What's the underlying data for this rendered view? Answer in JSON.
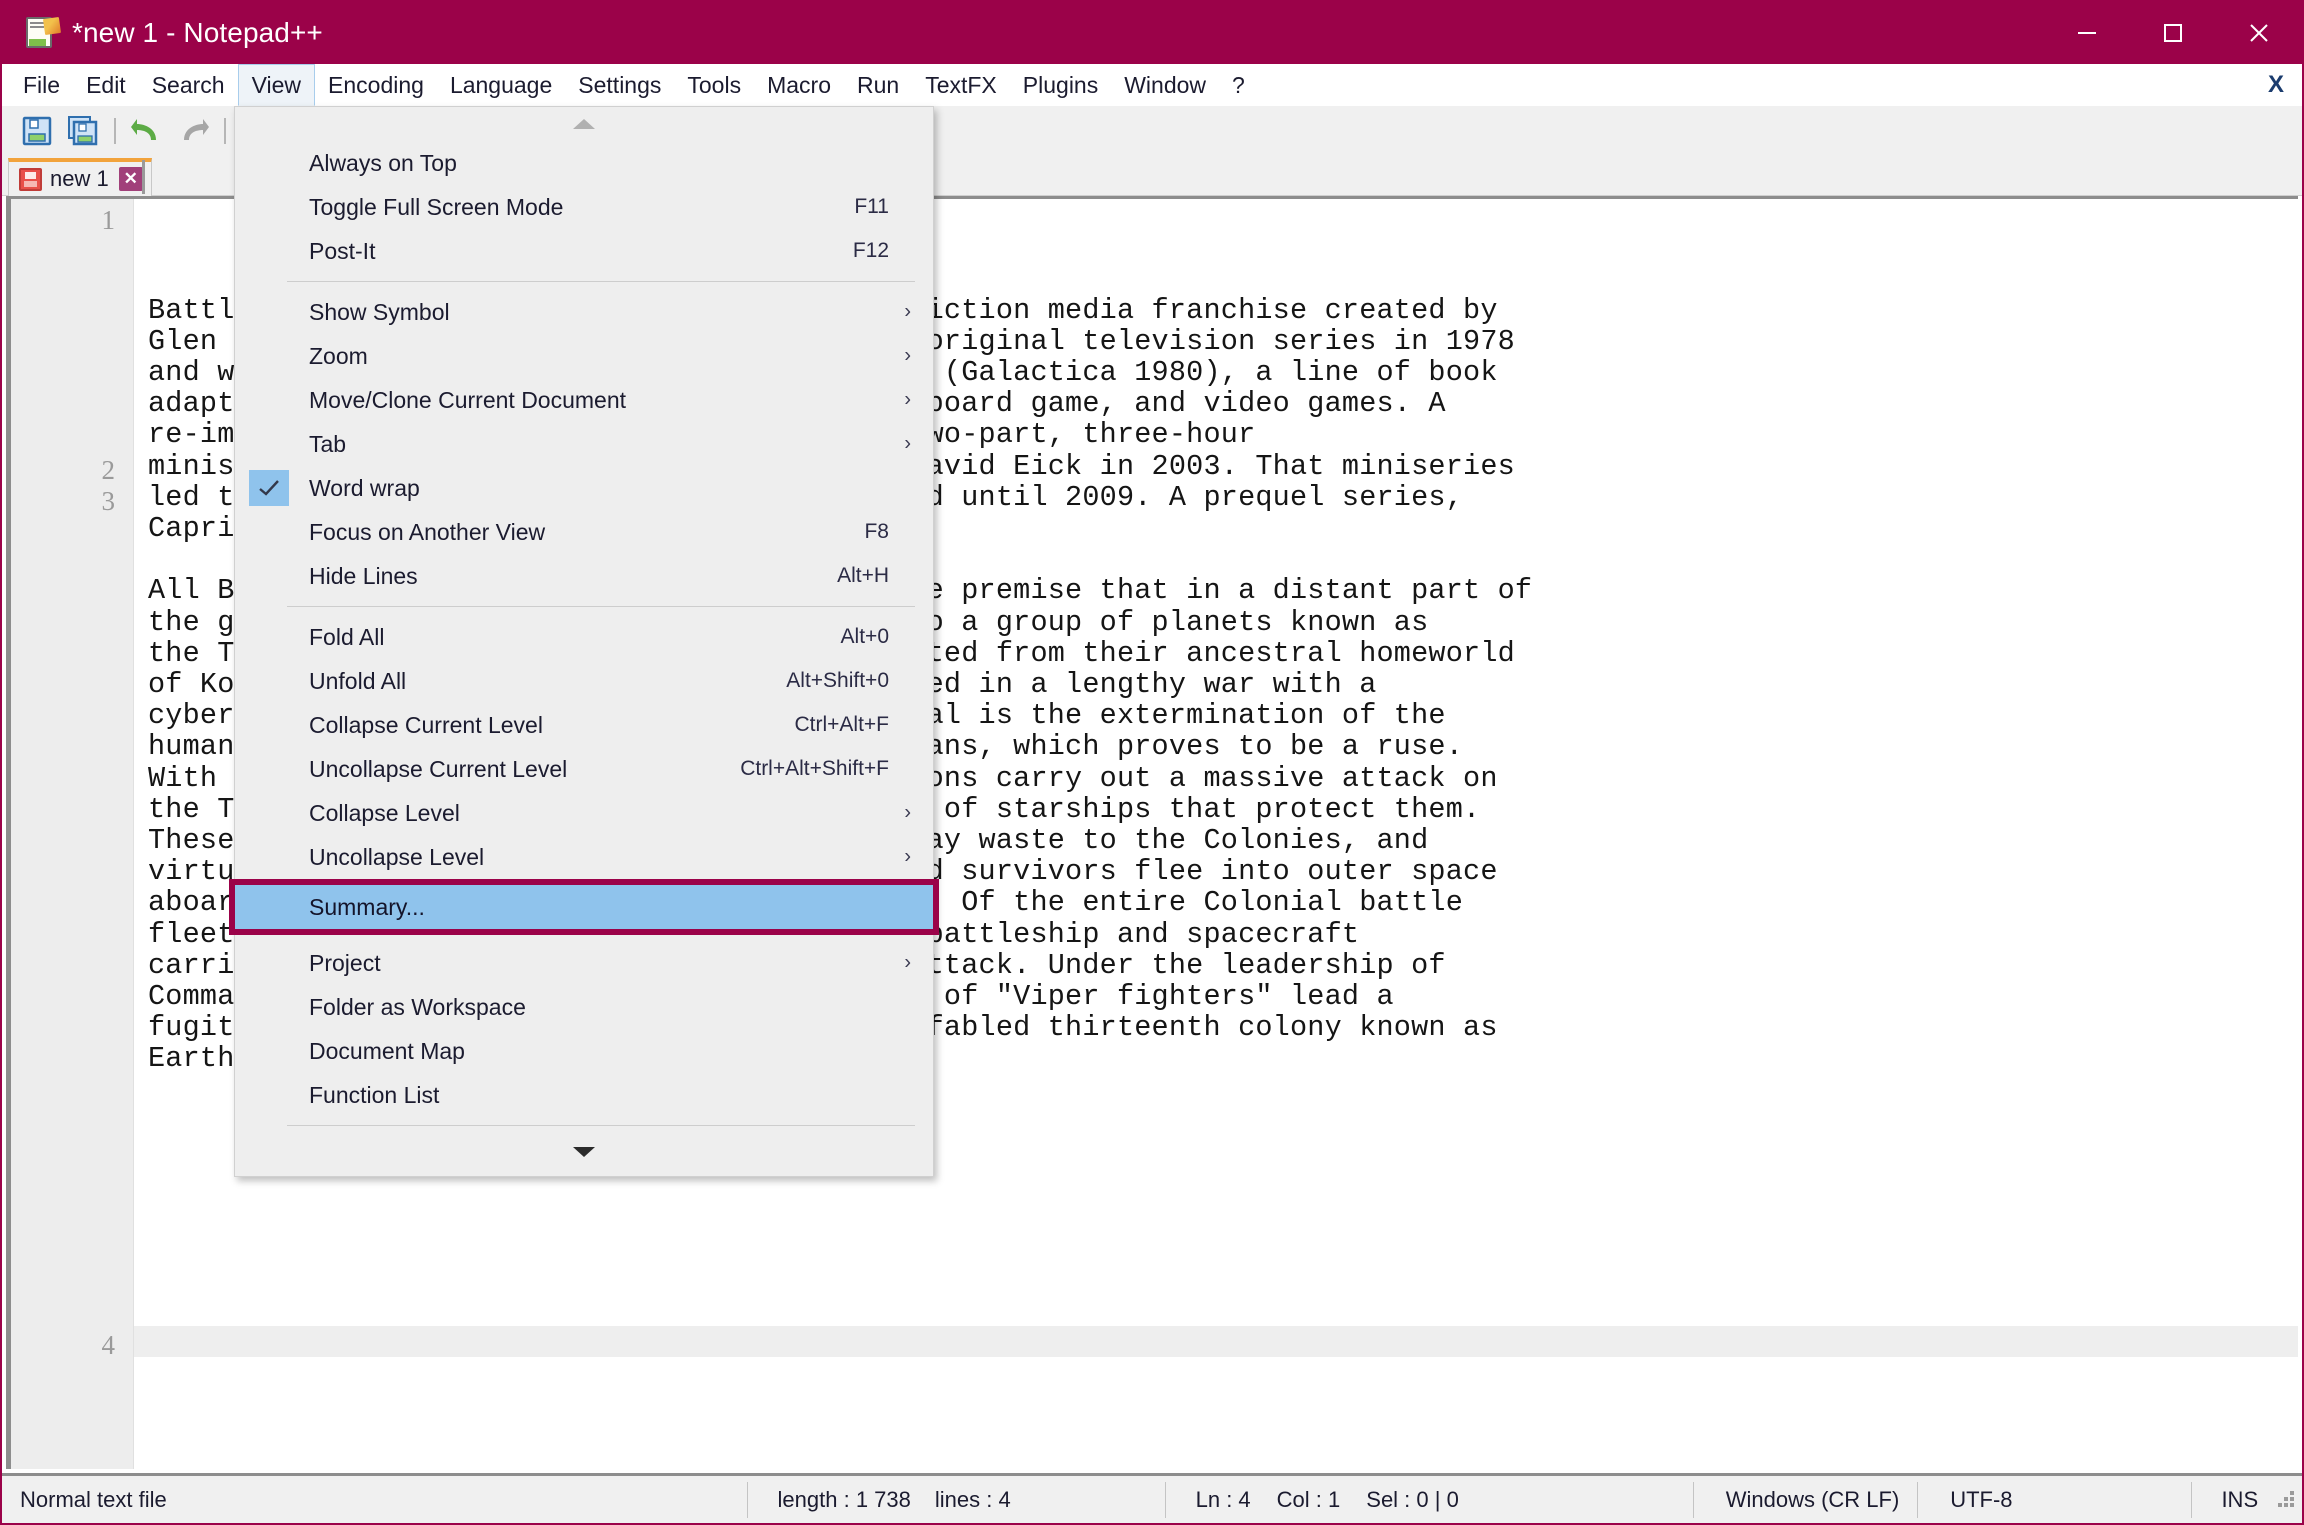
{
  "window": {
    "title": "*new 1 - Notepad++",
    "icon": "notepad-document-pencil-icon",
    "controls": {
      "minimize": "minimize-icon",
      "maximize": "maximize-icon",
      "close": "close-icon"
    },
    "titlebar_color": "#9B0249"
  },
  "menubar": {
    "items": [
      {
        "label": "File"
      },
      {
        "label": "Edit"
      },
      {
        "label": "Search"
      },
      {
        "label": "View",
        "active": true
      },
      {
        "label": "Encoding"
      },
      {
        "label": "Language"
      },
      {
        "label": "Settings"
      },
      {
        "label": "Tools"
      },
      {
        "label": "Macro"
      },
      {
        "label": "Run"
      },
      {
        "label": "TextFX"
      },
      {
        "label": "Plugins"
      },
      {
        "label": "Window"
      },
      {
        "label": "?"
      }
    ],
    "close_document_label": "X"
  },
  "toolbar": {
    "buttons": [
      {
        "name": "save-icon"
      },
      {
        "name": "save-all-icon"
      },
      {
        "name": "undo-icon"
      },
      {
        "name": "redo-icon"
      },
      {
        "name": "cut-icon"
      }
    ]
  },
  "tabbar": {
    "tabs": [
      {
        "label": "new 1",
        "modified": true,
        "close_label": "✕",
        "accent_color": "#f2a33c"
      }
    ]
  },
  "view_menu": {
    "scroll_up": "scroll-up-arrow",
    "scroll_down": "scroll-down-arrow",
    "items": [
      {
        "label": "Always on Top",
        "shortcut": "",
        "submenu": false
      },
      {
        "label": "Toggle Full Screen Mode",
        "shortcut": "F11",
        "submenu": false
      },
      {
        "label": "Post-It",
        "shortcut": "F12",
        "submenu": false
      },
      {
        "separator": true
      },
      {
        "label": "Show Symbol",
        "shortcut": "",
        "submenu": true
      },
      {
        "label": "Zoom",
        "shortcut": "",
        "submenu": true
      },
      {
        "label": "Move/Clone Current Document",
        "shortcut": "",
        "submenu": true
      },
      {
        "label": "Tab",
        "shortcut": "",
        "submenu": true
      },
      {
        "label": "Word wrap",
        "shortcut": "",
        "submenu": false,
        "checked": true
      },
      {
        "label": "Focus on Another View",
        "shortcut": "F8",
        "submenu": false
      },
      {
        "label": "Hide Lines",
        "shortcut": "Alt+H",
        "submenu": false
      },
      {
        "separator": true
      },
      {
        "label": "Fold All",
        "shortcut": "Alt+0",
        "submenu": false
      },
      {
        "label": "Unfold All",
        "shortcut": "Alt+Shift+0",
        "submenu": false
      },
      {
        "label": "Collapse Current Level",
        "shortcut": "Ctrl+Alt+F",
        "submenu": false
      },
      {
        "label": "Uncollapse Current Level",
        "shortcut": "Ctrl+Alt+Shift+F",
        "submenu": false
      },
      {
        "label": "Collapse Level",
        "shortcut": "",
        "submenu": true
      },
      {
        "label": "Uncollapse Level",
        "shortcut": "",
        "submenu": true
      },
      {
        "label": "Summary...",
        "shortcut": "",
        "submenu": false,
        "selected": true
      },
      {
        "label": "Project",
        "shortcut": "",
        "submenu": true
      },
      {
        "label": "Folder as Workspace",
        "shortcut": "",
        "submenu": false
      },
      {
        "label": "Document Map",
        "shortcut": "",
        "submenu": false
      },
      {
        "label": "Function List",
        "shortcut": "",
        "submenu": false
      },
      {
        "separator": true
      }
    ],
    "highlight_color": "#8fc3ec",
    "annotation_color": "#9B0249"
  },
  "editor": {
    "line_numbers": [
      "1",
      "2",
      "3",
      "4"
    ],
    "current_line": "4",
    "text": "Battlestar Galactica is an American science fiction media franchise created by\nGlen A. Larson. The franchise began with the original television series in 1978\nand was followed by a short-run sequel series (Galactica 1980), a line of book\nadaptations, original novels, comic books, a board game, and video games. A\nre-imagined Battlestar Galactica aired as a two-part, three-hour\nminiseries developed by Ronald D. Moore and David Eick in 2003. That miniseries\nled to a weekly television series, which aired until 2009. A prequel series,\nCaprica.\n\nAll Battlestar Galactica productions share the premise that in a distant part of\nthe galaxy, human civilization has extended to a group of planets known as\nthe Twelve Colonies, to which they have migrated from their ancestral homeworld\nof Kobol. The Twelve Colonies have been engaged in a lengthy war with a\ncybernetic race known as the Cylons, whose goal is the extermination of the\nhuman race. The Cylons offer peace to the humans, which proves to be a ruse.\nWith the aid of a human named Baltar, the Cylons carry out a massive attack on\nthe Twelve Colonies and on the Colonial Fleet of starships that protect them.\nThese attacks devastate the Colonial Fleet, lay waste to the Colonies, and\nvirtually destroy their populations. Scattered survivors flee into outer space\naboard a ragtag array of available spaceships. Of the entire Colonial battle\nfleet, only Battlestar Galactica, a gigantic battleship and spacecraft\ncarrier, appears to have survived the Cylon attack. Under the leadership of\nCommander Adama, the Galactica and the pilots of \"Viper fighters\" lead a\nfugitive fleet of survivors in search of the fabled thirteenth colony known as\nEarth.\n"
  },
  "statusbar": {
    "file_type": "Normal text file",
    "length_label": "length : 1 738",
    "lines_label": "lines : 4",
    "ln": "Ln : 4",
    "col": "Col : 1",
    "sel": "Sel : 0 | 0",
    "eol": "Windows (CR LF)",
    "encoding": "UTF-8",
    "insert_mode": "INS"
  }
}
